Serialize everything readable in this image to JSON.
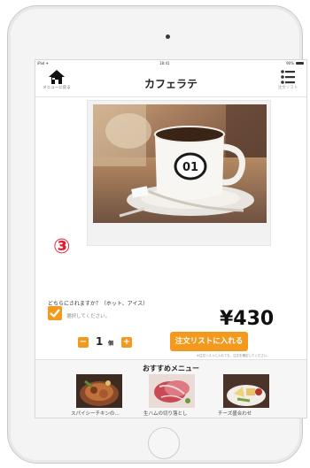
{
  "status_bar": {
    "carrier": "iPad ✈",
    "time": "18:41",
    "battery": "90%"
  },
  "nav": {
    "back_label": "メニューに戻る",
    "title": "カフェラテ",
    "list_label": "注文リスト"
  },
  "step_badge": "③",
  "option": {
    "question": "どちらにされますか？（ホット、アイス）",
    "hint": "選択してください。",
    "checked": true
  },
  "price": "¥430",
  "quantity": {
    "value": "1",
    "unit": "個",
    "minus": "−",
    "plus": "+"
  },
  "order": {
    "button_label": "注文リストに入れる",
    "note": "※注文リストに入れても、注文を確定してください。"
  },
  "recommend": {
    "title": "おすすめメニュー",
    "items": [
      {
        "label": "スパイシーチキンの…"
      },
      {
        "label": "生ハムの切り落とし"
      },
      {
        "label": "チーズ盛合わせ"
      }
    ]
  },
  "photo": {
    "cup_logo": "01"
  },
  "colors": {
    "accent": "#f39a1e",
    "badge": "#e01b2d"
  }
}
